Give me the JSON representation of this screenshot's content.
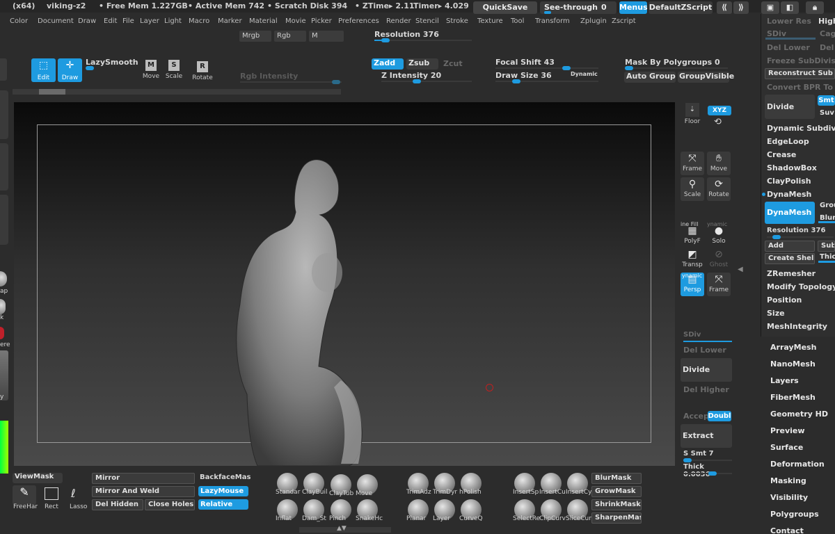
{
  "titlebar": {
    "app": "(x64)",
    "doc": "viking-z2",
    "free_mem": "• Free Mem 1.227GB",
    "active_mem": "• Active Mem 742",
    "scratch": "• Scratch Disk 394",
    "ztime": "• ZTime▸ 2.11",
    "timer": "Timer▸ 4.029",
    "quicksave": "QuickSave",
    "seethrough": "See-through",
    "seethrough_value": "0",
    "menus": "Menus",
    "default_zscript": "DefaultZScript"
  },
  "menubar": {
    "items": [
      "Color",
      "Document",
      "Draw",
      "Edit",
      "File",
      "Layer",
      "Light",
      "Macro",
      "Marker",
      "Material",
      "Movie",
      "Picker",
      "Preferences",
      "Render",
      "Stencil",
      "Stroke",
      "Texture",
      "Tool",
      "Transform",
      "Zplugin",
      "Zscript"
    ]
  },
  "toolbar": {
    "mrgb": "Mrgb",
    "rgb": "Rgb",
    "m": "M",
    "resolution_label": "Resolution 376",
    "resolution_value": 0.05,
    "edit": "Edit",
    "draw": "Draw",
    "lazysmooth": "LazySmooth",
    "move": "Move",
    "scale": "Scale",
    "rotate": "Rotate",
    "rgb_intensity": "Rgb Intensity",
    "zadd": "Zadd",
    "zsub": "Zsub",
    "zcut": "Zcut",
    "z_intensity": "Z Intensity 20",
    "focal_shift": "Focal Shift 43",
    "draw_size": "Draw Size 36",
    "dynamic": "Dynamic",
    "mask_by_polygroups": "Mask By Polygroups 0",
    "auto_group": "Auto Group",
    "group_visible": "GroupVisible"
  },
  "right_shelf": {
    "floor": "Floor",
    "xyz": "XYZ",
    "frame": "Frame",
    "move": "Move",
    "scale": "Scale",
    "rotate": "Rotate",
    "polyf": "PolyF",
    "line_fill": "ine Fill",
    "solo": "Solo",
    "dynamic": "ynamic",
    "transp": "Transp",
    "ghost": "Ghost",
    "persp": "Persp",
    "frame2": "Frame",
    "dynamic2": "ynamic",
    "sdiv": "SDiv",
    "del_lower": "Del Lower",
    "divide": "Divide",
    "del_higher": "Del Higher",
    "accep": "Accep",
    "doubl": "Doubl",
    "extract": "Extract",
    "s_smt": "S Smt 7",
    "thick": "Thick 0.0036"
  },
  "tool_panel": {
    "lower_res": "Lower Res",
    "high": "High",
    "sdiv": "SDiv",
    "cage": "Cage",
    "del_lower": "Del Lower",
    "del": "Del",
    "freeze": "Freeze SubDivision",
    "reconstruct": "Reconstruct Sub",
    "convert_bpr": "Convert BPR To",
    "divide": "Divide",
    "smt": "Smt",
    "suv": "Suv",
    "dynamic_subdiv": "Dynamic Subdiv",
    "edgeloop": "EdgeLoop",
    "crease": "Crease",
    "shadowbox": "ShadowBox",
    "claypolish": "ClayPolish",
    "dynamesh_header": "DynaMesh",
    "dynamesh_btn": "DynaMesh",
    "groups": "Grou",
    "blur": "Blur",
    "resolution": "Resolution 376",
    "add": "Add",
    "sub": "Sub",
    "create_shell": "Create Shell",
    "thick": "Thic",
    "zremesher": "ZRemesher",
    "modify_topology": "Modify Topology",
    "position": "Position",
    "size": "Size",
    "meshintegrity": "MeshIntegrity"
  },
  "tool_list": [
    "ArrayMesh",
    "NanoMesh",
    "Layers",
    "FiberMesh",
    "Geometry HD",
    "Preview",
    "Surface",
    "Deformation",
    "Masking",
    "Visibility",
    "Polygroups",
    "Contact"
  ],
  "bottom": {
    "viewmask": "ViewMask",
    "freehand": "FreeHar",
    "rect": "Rect",
    "lasso": "Lasso",
    "mirror": "Mirror",
    "mirror_weld": "Mirror And Weld",
    "del_hidden": "Del Hidden",
    "close_holes": "Close Holes",
    "backfacemask": "BackfaceMas",
    "lazymouse": "LazyMouse",
    "relative": "Relative",
    "brushes": [
      {
        "label": "Standar"
      },
      {
        "label": "ClayBuil"
      },
      {
        "label": "ClayTub"
      },
      {
        "label": "Move"
      },
      {
        "label": "Inflat"
      },
      {
        "label": "Dam_St"
      },
      {
        "label": "Pinch"
      },
      {
        "label": "SnakeHc"
      },
      {
        "label": "TrimAdz"
      },
      {
        "label": "TrimDyr"
      },
      {
        "label": "hPolish"
      },
      {
        "label": "Planar"
      },
      {
        "label": "Layer"
      },
      {
        "label": "CurveQ"
      },
      {
        "label": "InsertSp"
      },
      {
        "label": "InsertCu"
      },
      {
        "label": "InsertCy"
      },
      {
        "label": "SelectRe"
      },
      {
        "label": "ClipCurv"
      },
      {
        "label": "SliceCur"
      }
    ],
    "blurmask": "BlurMask",
    "growmask": "GrowMask",
    "shrinkmask": "ShrinkMask",
    "sharpenmask": "SharpenMas"
  },
  "left_shelf": {
    "ap": "ap",
    "k": "k",
    "ere": "ere",
    "y": "y"
  },
  "colors": {
    "accent": "#1e9be0",
    "background": "#2c2c2c"
  }
}
